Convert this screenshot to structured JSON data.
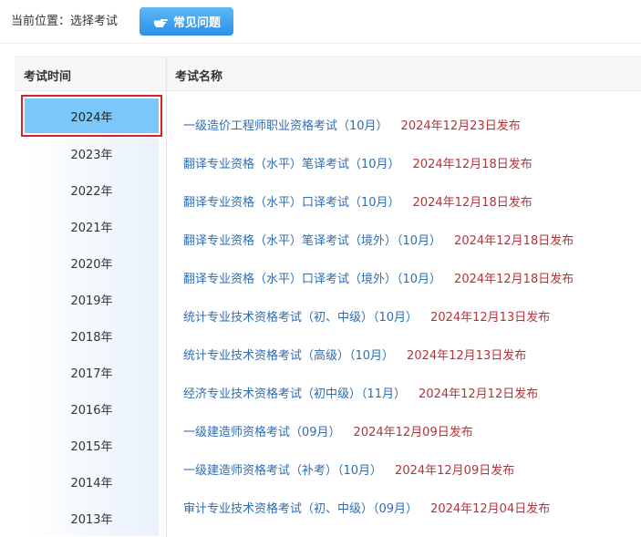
{
  "breadcrumb": "当前位置：选择考试",
  "faq_button": {
    "label": "常见问题",
    "icon": "pointing-hand-icon"
  },
  "table_header": {
    "year_column": "考试时间",
    "name_column": "考试名称"
  },
  "years": [
    "2024年",
    "2023年",
    "2022年",
    "2021年",
    "2020年",
    "2019年",
    "2018年",
    "2017年",
    "2016年",
    "2015年",
    "2014年",
    "2013年"
  ],
  "selected_year": "2024年",
  "exams": [
    {
      "name": "一级造价工程师职业资格考试（10月）",
      "date": "2024年12月23日发布"
    },
    {
      "name": "翻译专业资格（水平）笔译考试（10月）",
      "date": "2024年12月18日发布"
    },
    {
      "name": "翻译专业资格（水平）口译考试（10月）",
      "date": "2024年12月18日发布"
    },
    {
      "name": "翻译专业资格（水平）笔译考试（境外）（10月）",
      "date": "2024年12月18日发布"
    },
    {
      "name": "翻译专业资格（水平）口译考试（境外）（10月）",
      "date": "2024年12月18日发布"
    },
    {
      "name": "统计专业技术资格考试（初、中级）（10月）",
      "date": "2024年12月13日发布"
    },
    {
      "name": "统计专业技术资格考试（高级）（10月）",
      "date": "2024年12月13日发布"
    },
    {
      "name": "经济专业技术资格考试（初中级）（11月）",
      "date": "2024年12月12日发布"
    },
    {
      "name": "一级建造师资格考试（09月）",
      "date": "2024年12月09日发布"
    },
    {
      "name": "一级建造师资格考试（补考）（10月）",
      "date": "2024年12月09日发布"
    },
    {
      "name": "审计专业技术资格考试（初、中级）（09月）",
      "date": "2024年12月04日发布"
    }
  ],
  "colors": {
    "accent": "#2a8fe6",
    "link": "#2f6db3",
    "date": "#b0353a",
    "selected": "#7cc7fa",
    "highlight_border": "#d4232c"
  }
}
